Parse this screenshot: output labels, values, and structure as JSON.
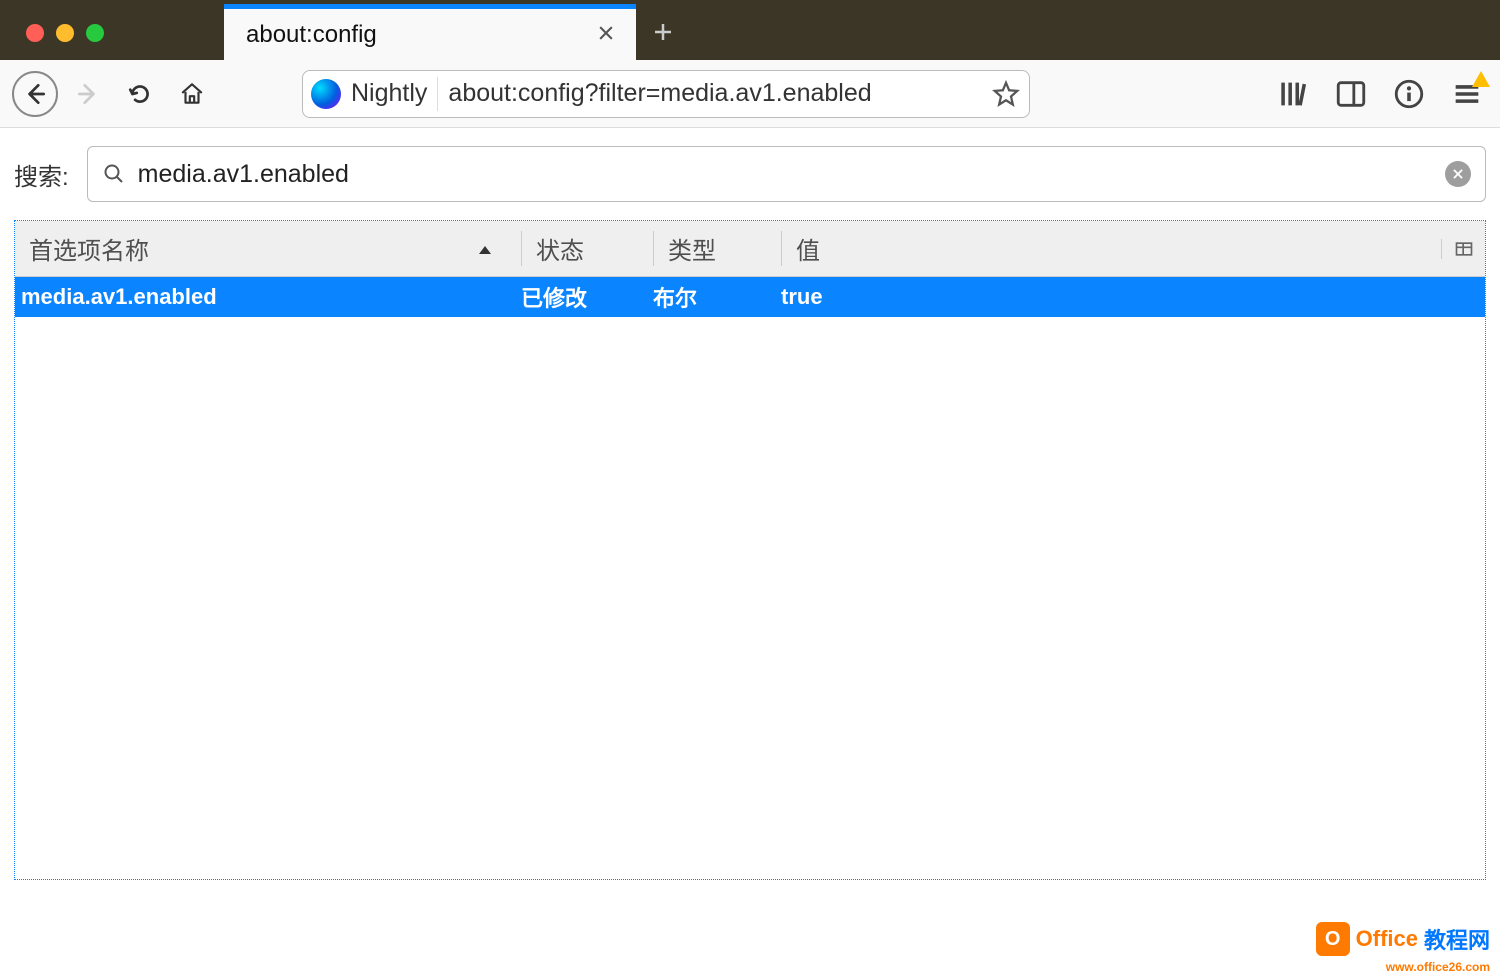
{
  "window": {
    "tab_title": "about:config"
  },
  "navbar": {
    "brand": "Nightly",
    "url": "about:config?filter=media.av1.enabled"
  },
  "search": {
    "label": "搜索:",
    "value": "media.av1.enabled"
  },
  "table": {
    "headers": {
      "name": "首选项名称",
      "status": "状态",
      "type": "类型",
      "value": "值"
    },
    "rows": [
      {
        "name": "media.av1.enabled",
        "status": "已修改",
        "type": "布尔",
        "value": "true"
      }
    ]
  },
  "watermark": {
    "brand1": "Office",
    "brand2": "教程网",
    "sub": "www.office26.com"
  }
}
